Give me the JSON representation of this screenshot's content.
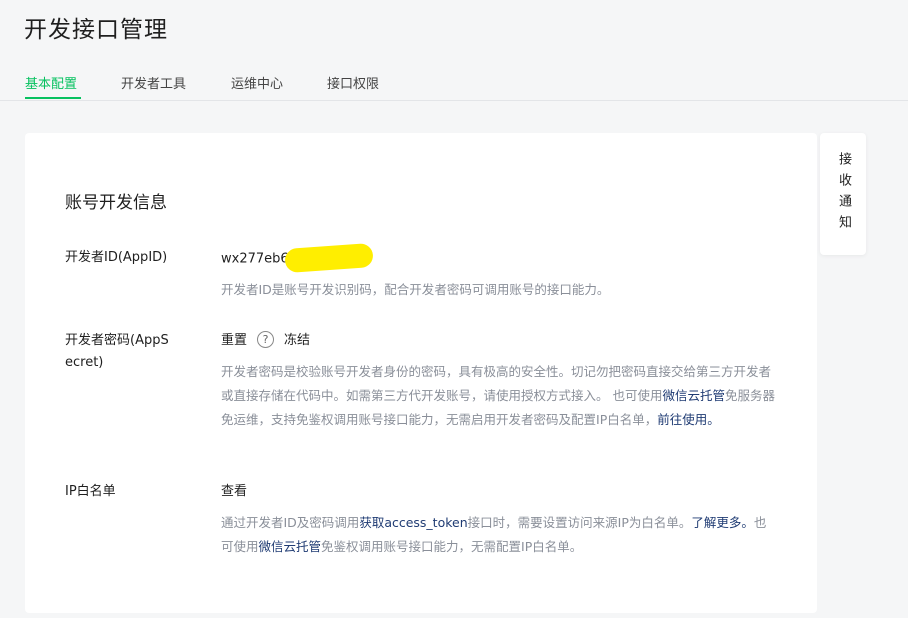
{
  "page": {
    "title": "开发接口管理"
  },
  "tabs": [
    {
      "label": "基本配置",
      "active": true
    },
    {
      "label": "开发者工具",
      "active": false
    },
    {
      "label": "运维中心",
      "active": false
    },
    {
      "label": "接口权限",
      "active": false
    }
  ],
  "section": {
    "title": "账号开发信息"
  },
  "appid": {
    "label": "开发者ID(AppID)",
    "value": "wx277eb6",
    "desc": "开发者ID是账号开发识别码，配合开发者密码可调用账号的接口能力。"
  },
  "secret": {
    "label": "开发者密码(AppSecret)",
    "reset": "重置",
    "help": "?",
    "freeze": "冻结",
    "desc_1": "开发者密码是校验账号开发者身份的密码，具有极高的安全性。切记勿把密码直接交给第三方开发者或直接存储在代码中。如需第三方代开发账号，请使用授权方式接入。 也可使用",
    "desc_link_1": "微信云托管",
    "desc_2": "免服务器免运维，支持免鉴权调用账号接口能力，无需启用开发者密码及配置IP白名单，",
    "desc_link_2": "前往使用。"
  },
  "ipwhitelist": {
    "label": "IP白名单",
    "view": "查看",
    "desc_1": "通过开发者ID及密码调用",
    "desc_link_1": "获取access_token",
    "desc_2": "接口时，需要设置访问来源IP为白名单。",
    "desc_link_2": "了解更多。",
    "desc_3": "也可使用",
    "desc_link_3": "微信云托管",
    "desc_4": "免鉴权调用账号接口能力，无需配置IP白名单。"
  },
  "side": {
    "label": "接收通知"
  },
  "colors": {
    "accent": "#07c160",
    "link": "#1f3b73",
    "muted": "#8a8f99"
  }
}
